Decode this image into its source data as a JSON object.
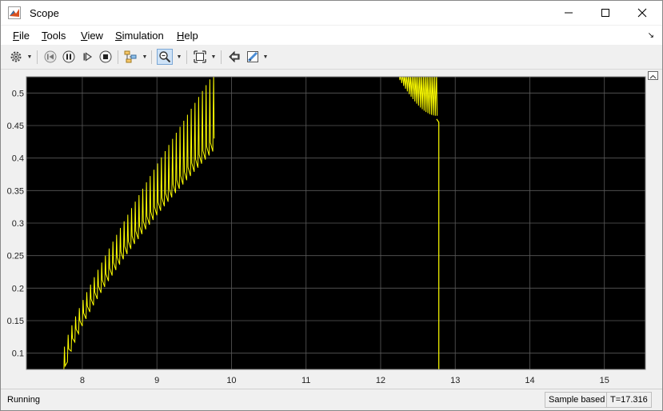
{
  "window": {
    "title": "Scope"
  },
  "menu": [
    {
      "label": "File",
      "mnemonic": "F",
      "rest": "ile"
    },
    {
      "label": "Tools",
      "mnemonic": "T",
      "rest": "ools"
    },
    {
      "label": "View",
      "mnemonic": "V",
      "rest": "iew"
    },
    {
      "label": "Simulation",
      "mnemonic": "S",
      "rest": "imulation"
    },
    {
      "label": "Help",
      "mnemonic": "H",
      "rest": "elp"
    }
  ],
  "toolbar": {
    "icons": [
      "settings-icon",
      "step-back-icon",
      "pause-icon",
      "step-forward-icon",
      "stop-icon",
      "signal-config-icon",
      "zoom-in-icon",
      "autoscale-icon",
      "cursor-measure-icon",
      "highlight-icon"
    ]
  },
  "status": {
    "state": "Running",
    "sample_mode": "Sample based",
    "time": "T=17.316"
  },
  "colors": {
    "plot_bg": "#000000",
    "grid": "#5a5a5a",
    "trace": "#ffff00",
    "axes_bg": "#f0f0f0"
  },
  "chart_data": {
    "type": "line",
    "xlim": [
      7.25,
      15.55
    ],
    "ylim": [
      0.075,
      0.525
    ],
    "x_ticks": [
      "8",
      "9",
      "10",
      "11",
      "12",
      "13",
      "14",
      "15"
    ],
    "x_tick_values": [
      8,
      9,
      10,
      11,
      12,
      13,
      14,
      15
    ],
    "y_ticks": [
      "0.5",
      "0.45",
      "0.4",
      "0.35",
      "0.3",
      "0.25",
      "0.2",
      "0.15",
      "0.1"
    ],
    "y_tick_values": [
      0.5,
      0.45,
      0.4,
      0.35,
      0.3,
      0.25,
      0.2,
      0.15,
      0.1
    ],
    "grid": true,
    "series": [
      {
        "color": "#ffff00",
        "segments": [
          {
            "x_start": 7.75,
            "x_end": 9.75,
            "cycles": 40,
            "top_start": 0.11,
            "top_end": 0.53,
            "bottom_start": 0.06,
            "bottom_end": 0.41
          },
          {
            "x_start": 12.25,
            "x_end": 12.75,
            "cycles": 20,
            "top": 0.53,
            "bottom_min": 0.465
          },
          {
            "x_start": 12.75,
            "x_end": 12.78,
            "drop_from": 0.46,
            "drop_to": 0.06
          }
        ]
      }
    ]
  }
}
